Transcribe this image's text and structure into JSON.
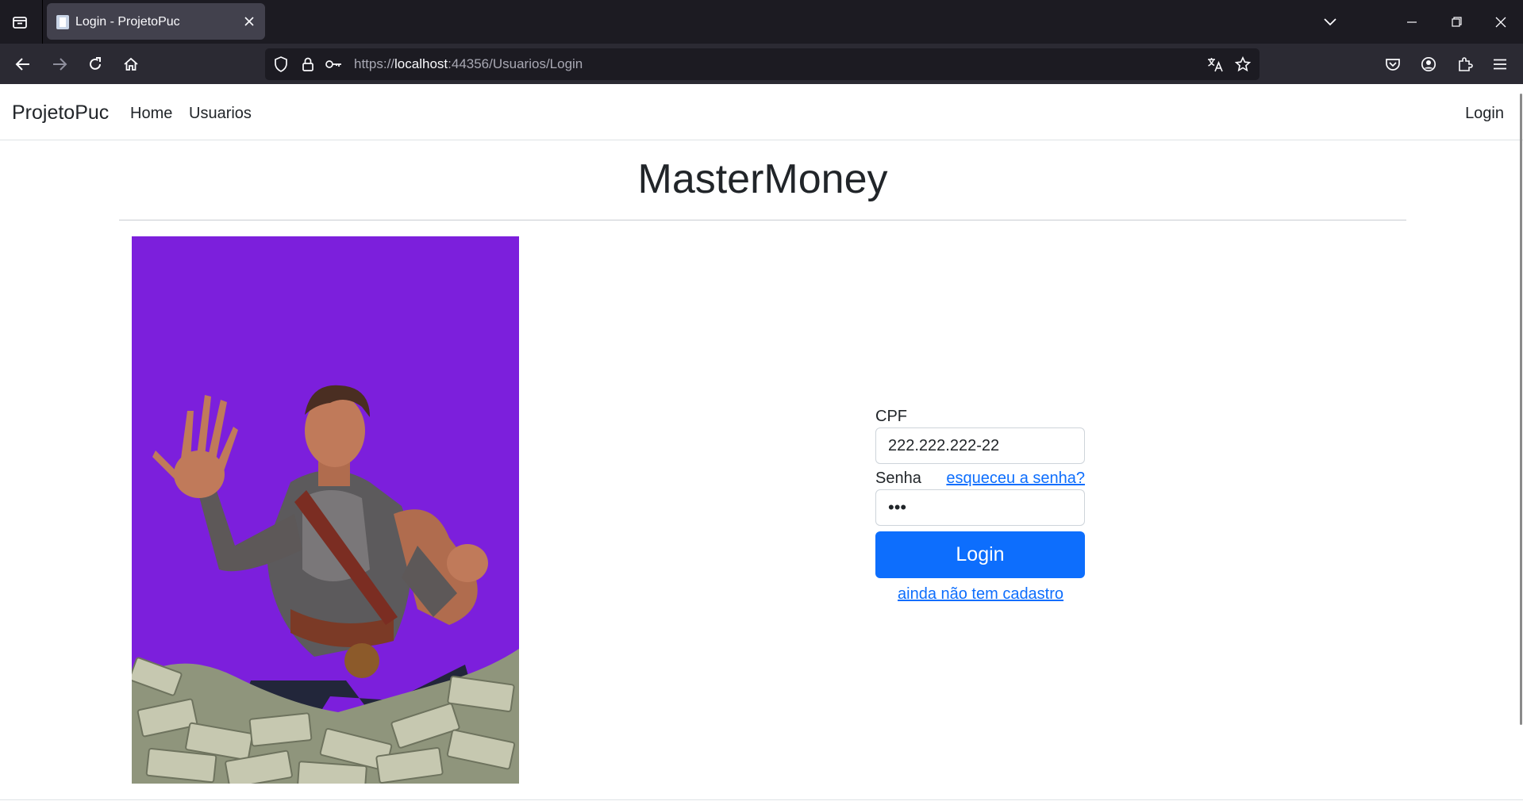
{
  "browser": {
    "tab_title": "Login - ProjetoPuc",
    "url_prefix": "https://",
    "url_host": "localhost",
    "url_rest": ":44356/Usuarios/Login"
  },
  "site": {
    "brand": "ProjetoPuc",
    "nav": [
      "Home",
      "Usuarios"
    ],
    "nav_right": "Login",
    "heading": "MasterMoney"
  },
  "form": {
    "cpf_label": "CPF",
    "cpf_value": "222.222.222-22",
    "senha_label": "Senha",
    "forgot_link": "esqueceu a senha?",
    "password_value": "•••",
    "login_button": "Login",
    "register_link": "ainda não tem cadastro"
  },
  "colors": {
    "accent": "#0d6efd",
    "hero_bg": "#7c1fdc",
    "tab_bar": "#1c1b22",
    "toolbar": "#2b2a33"
  }
}
